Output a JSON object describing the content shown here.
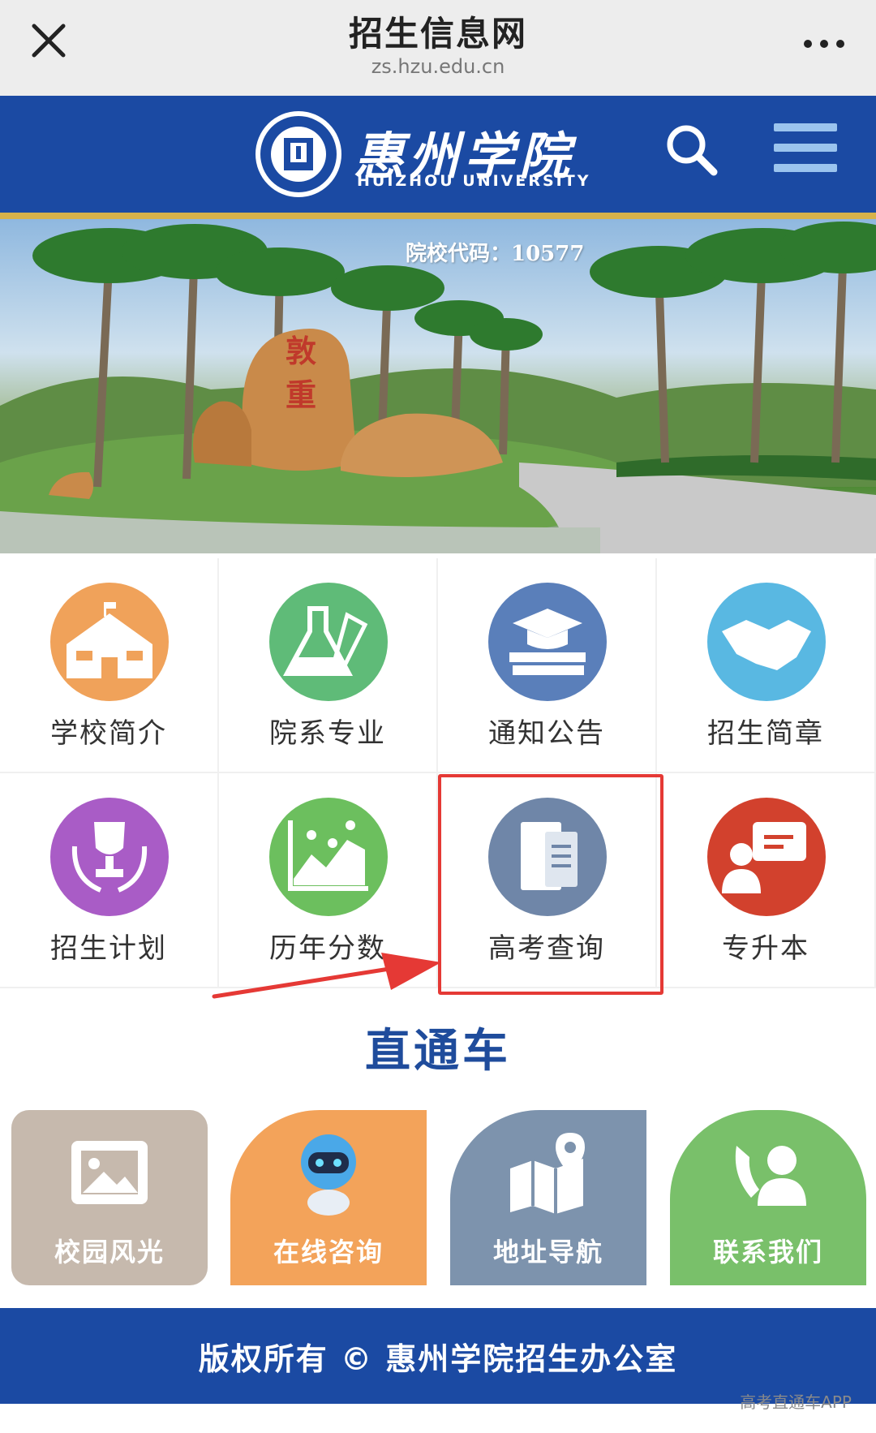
{
  "browser": {
    "title": "招生信息网",
    "url": "zs.hzu.edu.cn",
    "close_icon": "close-icon",
    "more_icon": "more-icon"
  },
  "header": {
    "brand_cn": "惠州学院",
    "brand_en": "HUIZHOU UNIVERSITY",
    "search_icon": "search-icon",
    "menu_icon": "hamburger-menu-icon",
    "colors": {
      "primary": "#1b4aa3",
      "gold": "#d7b24a"
    }
  },
  "banner": {
    "code_text": "院校代码：10577",
    "rock_text": [
      "敦",
      "重"
    ]
  },
  "menu": [
    {
      "label": "学校简介",
      "icon": "school-building-icon",
      "color": "#f0a25a"
    },
    {
      "label": "院系专业",
      "icon": "flask-icon",
      "color": "#5fbb78"
    },
    {
      "label": "通知公告",
      "icon": "graduation-cap-books-icon",
      "color": "#5a7fba"
    },
    {
      "label": "招生简章",
      "icon": "handshake-icon",
      "color": "#59b8e2"
    },
    {
      "label": "招生计划",
      "icon": "trophy-icon",
      "color": "#a95cc6"
    },
    {
      "label": "历年分数",
      "icon": "line-chart-icon",
      "color": "#6cbf5e"
    },
    {
      "label": "高考查询",
      "icon": "document-folder-icon",
      "color": "#6f86a8"
    },
    {
      "label": "专升本",
      "icon": "presenter-icon",
      "color": "#d2412d"
    }
  ],
  "section_title": "直通车",
  "tiles": [
    {
      "label": "校园风光",
      "icon": "picture-frame-icon",
      "color": "#c6b9ad"
    },
    {
      "label": "在线咨询",
      "icon": "robot-icon",
      "color": "#f3a35a"
    },
    {
      "label": "地址导航",
      "icon": "map-pin-icon",
      "color": "#7d93ad"
    },
    {
      "label": "联系我们",
      "icon": "phone-contact-icon",
      "color": "#79c06a"
    }
  ],
  "footer": {
    "copyright": "版权所有 © 惠州学院招生办公室"
  },
  "watermark": "高考直通车APP"
}
